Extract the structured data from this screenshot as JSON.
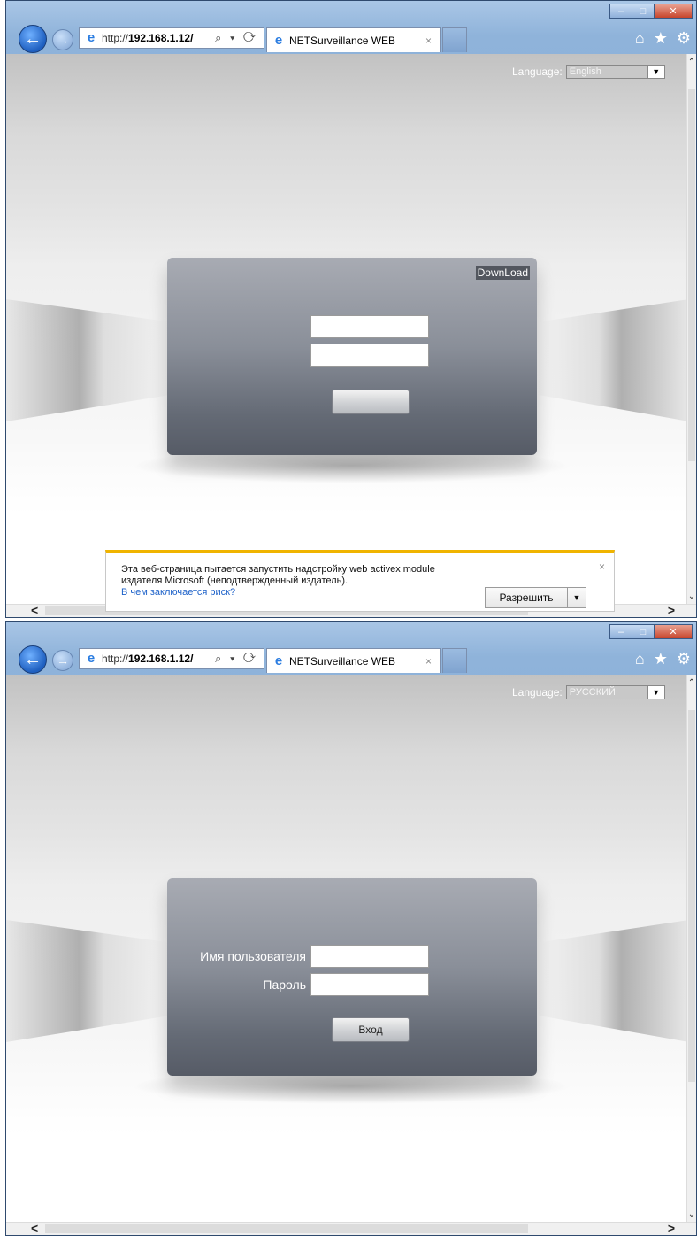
{
  "windows": [
    {
      "address": {
        "url_prefix": "http://",
        "url_host": "192.168.1.12/",
        "tools": "⌕ ▾ ⟳"
      },
      "tab": {
        "title": "NETSurveillance WEB",
        "close": "×"
      },
      "page": {
        "language": {
          "label": "Language:",
          "selected": "English"
        },
        "download_label": "DownLoad",
        "username_label": "",
        "password_label": "",
        "login_label": ""
      },
      "notification": {
        "line1": "Эта веб-страница пытается запустить надстройку web activex  module",
        "line2": "издателя Microsoft (неподтвержденный издатель).",
        "link": "В чем заключается риск?",
        "allow_label": "Разрешить",
        "close": "×"
      }
    },
    {
      "address": {
        "url_prefix": "http://",
        "url_host": "192.168.1.12/",
        "tools": "⌕ ▾ ⟳"
      },
      "tab": {
        "title": "NETSurveillance WEB",
        "close": "×"
      },
      "page": {
        "language": {
          "label": "Language:",
          "selected": "РУССКИЙ"
        },
        "username_label": "Имя пользователя",
        "password_label": "Пароль",
        "login_label": "Вход"
      }
    }
  ],
  "icons": [
    "back-arrow-icon",
    "forward-arrow-icon",
    "ie-logo-icon",
    "search-icon",
    "refresh-icon",
    "home-icon",
    "favorites-star-icon",
    "settings-gear-icon",
    "minimize-icon",
    "maximize-icon",
    "close-icon"
  ],
  "colors": {
    "notification_accent": "#f0b400",
    "link": "#1e62c9",
    "panel_dark": "#565b66"
  }
}
